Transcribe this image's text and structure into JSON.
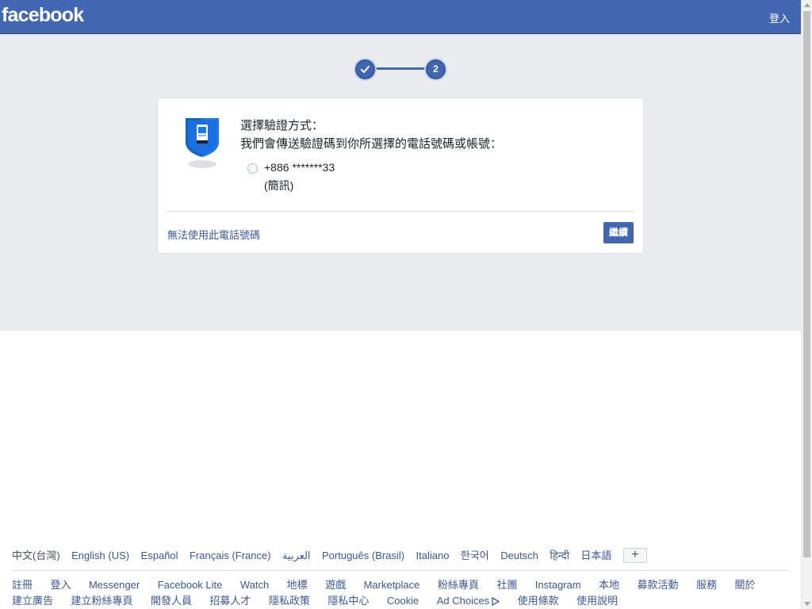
{
  "header": {
    "logo": "facebook",
    "login_link": "登入"
  },
  "stepper": {
    "step2_label": "2"
  },
  "card": {
    "title": "選擇驗證方式：",
    "description": "我們會傳送驗證碼到你所選擇的電話號碼或帳號：",
    "option_number": "+886 *******33",
    "option_note": "(簡訊)",
    "alternate_link": "無法使用此電話號碼",
    "continue_button": "繼續"
  },
  "footer": {
    "languages": [
      "中文(台灣)",
      "English (US)",
      "Español",
      "Français (France)",
      "العربية",
      "Português (Brasil)",
      "Italiano",
      "한국어",
      "Deutsch",
      "हिन्दी",
      "日本語"
    ],
    "more_languages_button": "+",
    "links": [
      "註冊",
      "登入",
      "Messenger",
      "Facebook Lite",
      "Watch",
      "地標",
      "遊戲",
      "Marketplace",
      "粉絲專頁",
      "社團",
      "Instagram",
      "本地",
      "募款活動",
      "服務",
      "關於",
      "建立廣告",
      "建立粉絲專頁",
      "開發人員",
      "招募人才",
      "隱私政策",
      "隱私中心",
      "Cookie",
      "Ad Choices",
      "使用條款",
      "使用說明"
    ]
  },
  "colors": {
    "brand_blue": "#4267b2",
    "link_blue": "#385898",
    "grey_background": "#e9ebee"
  },
  "icons": {
    "step1": "check-icon",
    "card": "shield-phone-icon",
    "adchoices": "adchoices-icon"
  }
}
